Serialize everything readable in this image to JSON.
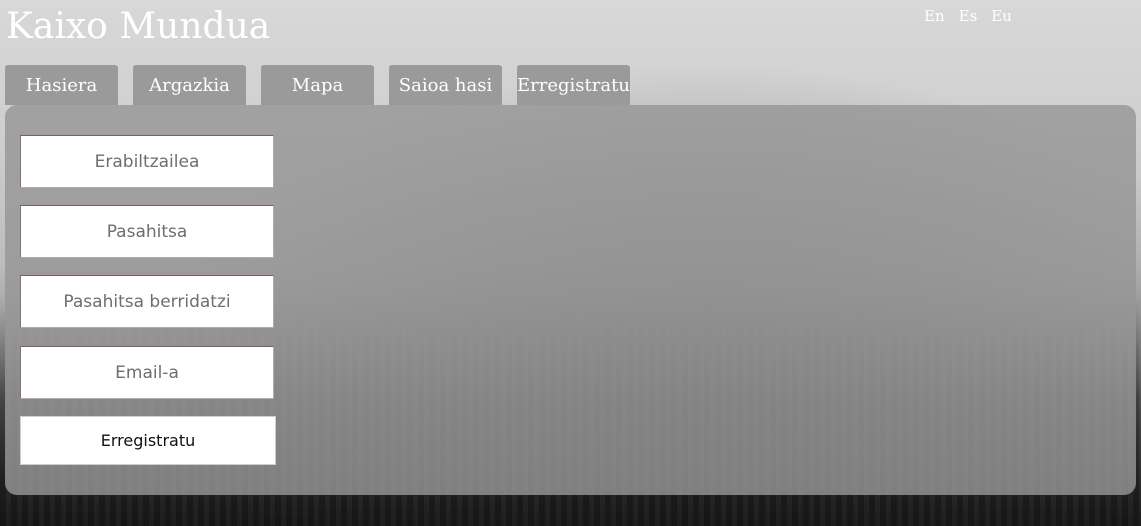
{
  "header": {
    "title": "Kaixo Mundua",
    "languages": [
      "En",
      "Es",
      "Eu"
    ]
  },
  "nav": {
    "tabs": [
      {
        "label": "Hasiera"
      },
      {
        "label": "Argazkia"
      },
      {
        "label": "Mapa"
      },
      {
        "label": "Saioa hasi"
      },
      {
        "label": "Erregistratu"
      }
    ]
  },
  "register_form": {
    "username_placeholder": "Erabiltzailea",
    "password_placeholder": "Pasahitsa",
    "password_repeat_placeholder": "Pasahitsa berridatzi",
    "email_placeholder": "Email-a",
    "submit_label": "Erregistratu"
  },
  "colors": {
    "tab_background": "#9a9a9a",
    "panel_background": "#969696",
    "text_light": "#ffffff"
  }
}
